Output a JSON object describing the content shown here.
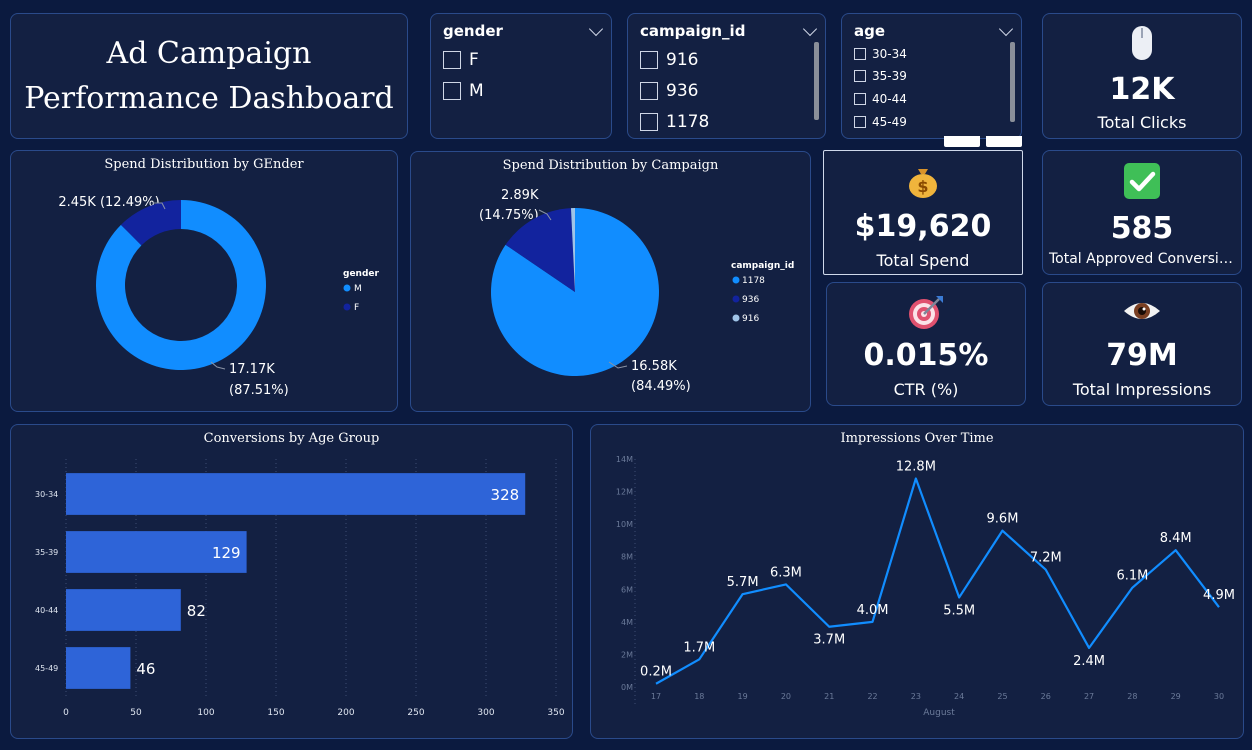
{
  "title": {
    "line1": "Ad Campaign",
    "line2": "Performance Dashboard"
  },
  "slicers": {
    "gender": {
      "header": "gender",
      "options": [
        "F",
        "M"
      ]
    },
    "campaign": {
      "header": "campaign_id",
      "options": [
        "916",
        "936",
        "1178"
      ]
    },
    "age": {
      "header": "age",
      "options": [
        "30-34",
        "35-39",
        "40-44",
        "45-49"
      ]
    }
  },
  "kpis": {
    "clicks": {
      "icon": "mouse-icon",
      "value": "12K",
      "label": "Total Clicks"
    },
    "spend": {
      "icon": "money-bag-icon",
      "value": "$19,620",
      "label": "Total Spend"
    },
    "conversions": {
      "icon": "check-mark-icon",
      "value": "585",
      "label": "Total Approved Conversio..."
    },
    "ctr": {
      "icon": "target-icon",
      "value": "0.015%",
      "label": "CTR (%)"
    },
    "impressions": {
      "icon": "eye-icon",
      "value": "79M",
      "label": "Total Impressions"
    }
  },
  "colors": {
    "accent": "#118dff",
    "dark_series": "#12239e",
    "light_series": "#a0c4e8",
    "bar": "#2e64d8",
    "background": "#0b1a3f",
    "card": "#132042"
  },
  "chart_data": [
    {
      "type": "pie",
      "variant": "donut",
      "title": "Spend Distribution by GEnder",
      "legend_title": "gender",
      "legend_position": "right",
      "slices": [
        {
          "name": "M",
          "value": 17170,
          "label": "17.17K",
          "pct_label": "(87.51%)",
          "color": "#118dff"
        },
        {
          "name": "F",
          "value": 2450,
          "label": "2.45K",
          "pct_label": "(12.49%)",
          "color": "#12239e"
        }
      ]
    },
    {
      "type": "pie",
      "title": "Spend Distribution by Campaign",
      "legend_title": "campaign_id",
      "legend_position": "right",
      "slices": [
        {
          "name": "1178",
          "value": 16580,
          "label": "16.58K",
          "pct_label": "(84.49%)",
          "color": "#118dff"
        },
        {
          "name": "936",
          "value": 2890,
          "label": "2.89K",
          "pct_label": "(14.75%)",
          "color": "#12239e"
        },
        {
          "name": "916",
          "value": 150,
          "color": "#a0c4e8"
        }
      ]
    },
    {
      "type": "bar",
      "orientation": "horizontal",
      "title": "Conversions by Age Group",
      "categories": [
        "30-34",
        "35-39",
        "40-44",
        "45-49"
      ],
      "values": [
        328,
        129,
        82,
        46
      ],
      "xlim": [
        0,
        350
      ],
      "xticks": [
        0,
        50,
        100,
        150,
        200,
        250,
        300,
        350
      ],
      "grid": true
    },
    {
      "type": "line",
      "title": "Impressions Over Time",
      "xlabel": "August",
      "x": [
        17,
        18,
        19,
        20,
        21,
        22,
        23,
        24,
        25,
        26,
        27,
        28,
        29,
        30
      ],
      "y": [
        0.2,
        1.7,
        5.7,
        6.3,
        3.7,
        4.0,
        12.8,
        5.5,
        9.6,
        7.2,
        2.4,
        6.1,
        8.4,
        4.9
      ],
      "labels": [
        "0.2M",
        "1.7M",
        "5.7M",
        "6.3M",
        "3.7M",
        "4.0M",
        "12.8M",
        "5.5M",
        "9.6M",
        "7.2M",
        "2.4M",
        "6.1M",
        "8.4M",
        "4.9M"
      ],
      "ylim": [
        0,
        14
      ],
      "yticks": [
        "0M",
        "2M",
        "4M",
        "6M",
        "8M",
        "10M",
        "12M",
        "14M"
      ],
      "grid": false
    }
  ]
}
